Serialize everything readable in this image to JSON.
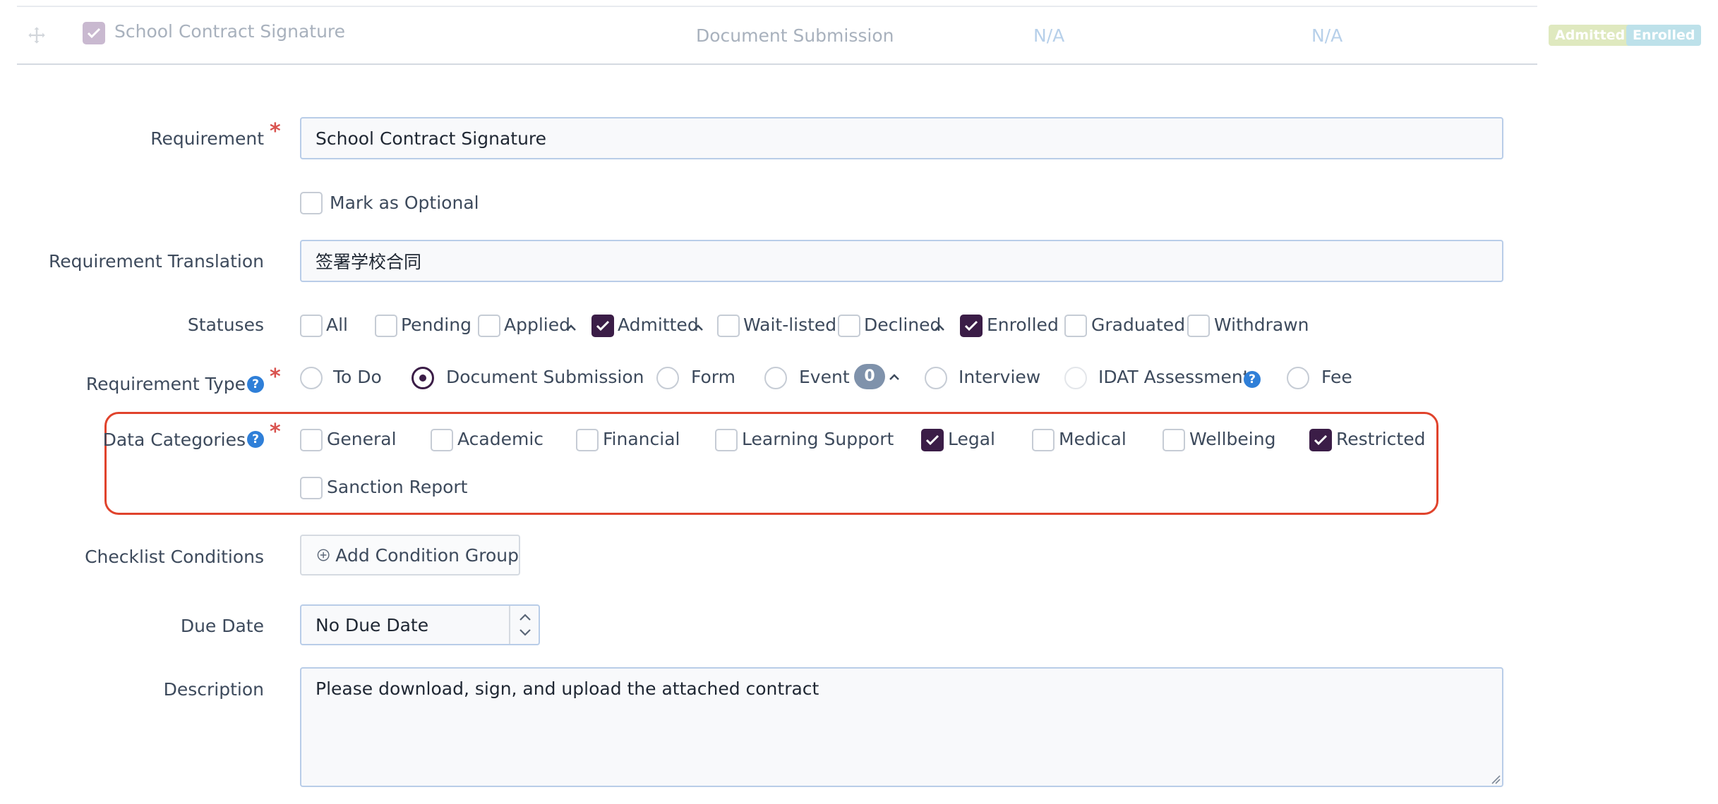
{
  "header": {
    "title": "School Contract Signature",
    "type": "Document Submission",
    "col1": "N/A",
    "col2": "N/A",
    "badges": [
      "Admitted",
      "Enrolled"
    ]
  },
  "form": {
    "requirement": {
      "label": "Requirement",
      "value": "School Contract Signature"
    },
    "optional": {
      "label": "Mark as Optional",
      "checked": false
    },
    "translation": {
      "label": "Requirement Translation",
      "value": "签署学校合同"
    },
    "statuses": {
      "label": "Statuses",
      "options": [
        {
          "label": "All",
          "checked": false
        },
        {
          "label": "Pending",
          "checked": false
        },
        {
          "label": "Applied",
          "checked": false,
          "expandable": true
        },
        {
          "label": "Admitted",
          "checked": true,
          "expandable": true
        },
        {
          "label": "Wait-listed",
          "checked": false
        },
        {
          "label": "Declined",
          "checked": false,
          "expandable": true
        },
        {
          "label": "Enrolled",
          "checked": true
        },
        {
          "label": "Graduated",
          "checked": false
        },
        {
          "label": "Withdrawn",
          "checked": false
        }
      ]
    },
    "requirement_type": {
      "label": "Requirement Type",
      "options": [
        {
          "label": "To Do",
          "selected": false
        },
        {
          "label": "Document Submission",
          "selected": true
        },
        {
          "label": "Form",
          "selected": false
        },
        {
          "label": "Event",
          "selected": false,
          "count": "0"
        },
        {
          "label": "Interview",
          "selected": false
        },
        {
          "label": "IDAT Assessment",
          "selected": false,
          "disabled": true
        },
        {
          "label": "Fee",
          "selected": false
        }
      ]
    },
    "data_categories": {
      "label": "Data Categories",
      "options": [
        {
          "label": "General",
          "checked": false
        },
        {
          "label": "Academic",
          "checked": false
        },
        {
          "label": "Financial",
          "checked": false
        },
        {
          "label": "Learning Support",
          "checked": false
        },
        {
          "label": "Legal",
          "checked": true
        },
        {
          "label": "Medical",
          "checked": false
        },
        {
          "label": "Wellbeing",
          "checked": false
        },
        {
          "label": "Restricted",
          "checked": true
        },
        {
          "label": "Sanction Report",
          "checked": false
        }
      ]
    },
    "checklist": {
      "label": "Checklist Conditions",
      "button": "Add Condition Group"
    },
    "due_date": {
      "label": "Due Date",
      "value": "No Due Date"
    },
    "description": {
      "label": "Description",
      "value": "Please download, sign, and upload the attached contract"
    }
  },
  "colors": {
    "accent": "#3b1d47",
    "highlight": "#e0432c",
    "help": "#2f7fd8",
    "required": "#d9534f"
  }
}
